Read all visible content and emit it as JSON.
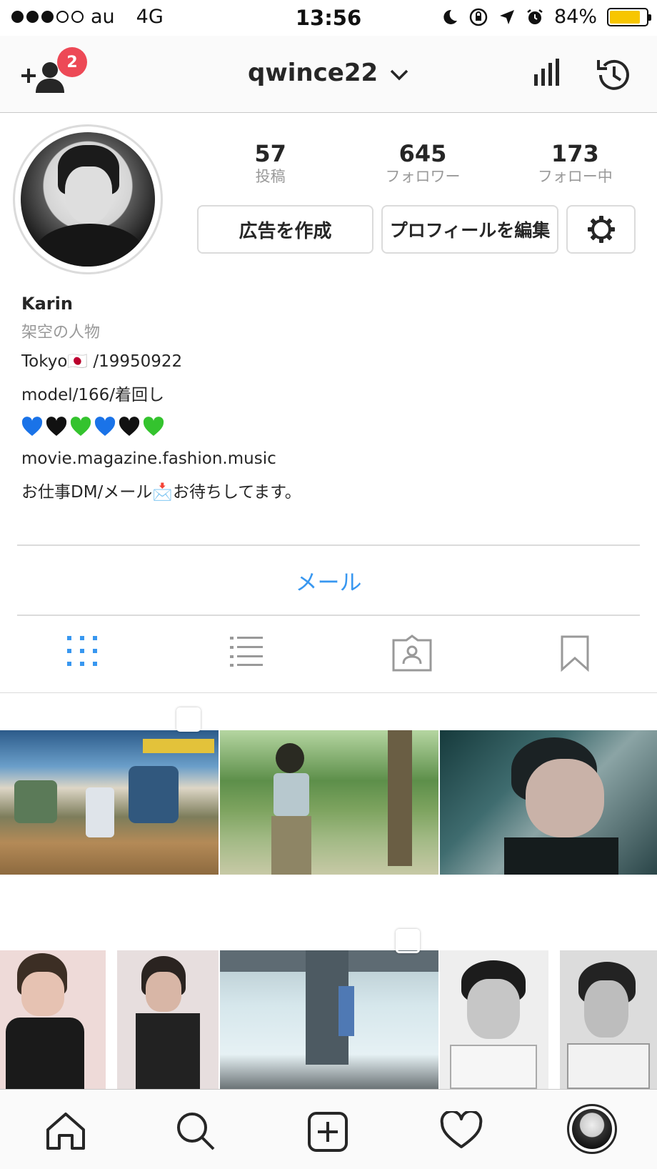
{
  "status_bar": {
    "carrier": "au",
    "network": "4G",
    "time": "13:56",
    "battery": "84%",
    "battery_level": 0.84,
    "battery_color": "#f7c600"
  },
  "nav": {
    "username": "qwince22",
    "friend_request_badge": "2",
    "icons": [
      "add-person-icon",
      "chevron-down-icon",
      "insights-icon",
      "history-icon"
    ]
  },
  "stats": [
    {
      "num": "57",
      "label": "投稿"
    },
    {
      "num": "645",
      "label": "フォロワー"
    },
    {
      "num": "173",
      "label": "フォロー中"
    }
  ],
  "buttons": {
    "create_ad": "広告を作成",
    "edit_profile": "プロフィールを編集"
  },
  "bio": {
    "name": "Karin",
    "category": "架空の人物",
    "line1": "Tokyo🇯🇵 /19950922",
    "line2": "model/166/着回し",
    "hearts": [
      "blue",
      "black",
      "green",
      "blue",
      "black",
      "green"
    ],
    "line3": "movie.magazine.fashion.music",
    "line4": "お仕事DM/メール📩お待ちしてます。"
  },
  "mail_button": "メール",
  "tabs": [
    "grid-icon",
    "list-icon",
    "tagged-icon",
    "saved-icon"
  ],
  "colors": {
    "accent": "#3897f0",
    "badge": "#ed4956",
    "heart_blue": "#1a73e8",
    "heart_black": "#111111",
    "heart_green": "#34c32e"
  },
  "bottom_tabs": [
    "home-icon",
    "search-icon",
    "add-post-icon",
    "activity-heart-icon",
    "profile-avatar"
  ]
}
